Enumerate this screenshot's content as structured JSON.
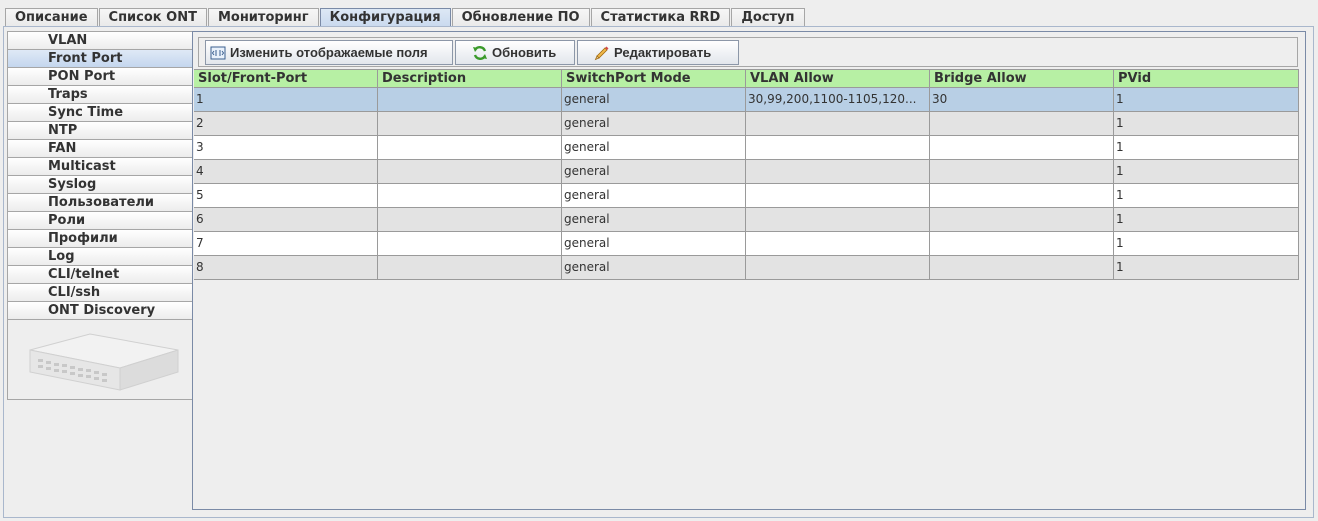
{
  "tabs": [
    {
      "label": "Описание",
      "active": false
    },
    {
      "label": "Список ONT",
      "active": false
    },
    {
      "label": "Мониторинг",
      "active": false
    },
    {
      "label": "Конфигурация",
      "active": true
    },
    {
      "label": "Обновление ПО",
      "active": false
    },
    {
      "label": "Статистика RRD",
      "active": false
    },
    {
      "label": "Доступ",
      "active": false
    }
  ],
  "sidebar": {
    "items": [
      {
        "label": "VLAN",
        "active": false
      },
      {
        "label": "Front Port",
        "active": true
      },
      {
        "label": "PON Port",
        "active": false
      },
      {
        "label": "Traps",
        "active": false
      },
      {
        "label": "Sync Time",
        "active": false
      },
      {
        "label": "NTP",
        "active": false
      },
      {
        "label": "FAN",
        "active": false
      },
      {
        "label": "Multicast",
        "active": false
      },
      {
        "label": "Syslog",
        "active": false
      },
      {
        "label": "Пользователи",
        "active": false
      },
      {
        "label": "Роли",
        "active": false
      },
      {
        "label": "Профили",
        "active": false
      },
      {
        "label": "Log",
        "active": false
      },
      {
        "label": "CLI/telnet",
        "active": false
      },
      {
        "label": "CLI/ssh",
        "active": false
      },
      {
        "label": "ONT Discovery",
        "active": false
      }
    ]
  },
  "toolbar": {
    "fields_label": "Изменить отображаемые поля",
    "refresh_label": "Обновить",
    "edit_label": "Редактировать"
  },
  "table": {
    "headers": [
      "Slot/Front-Port",
      "Description",
      "SwitchPort Mode",
      "VLAN Allow",
      "Bridge Allow",
      "PVid"
    ],
    "rows": [
      [
        "1",
        "",
        "general",
        "30,99,200,1100-1105,120...",
        "30",
        "1"
      ],
      [
        "2",
        "",
        "general",
        "",
        "",
        "1"
      ],
      [
        "3",
        "",
        "general",
        "",
        "",
        "1"
      ],
      [
        "4",
        "",
        "general",
        "",
        "",
        "1"
      ],
      [
        "5",
        "",
        "general",
        "",
        "",
        "1"
      ],
      [
        "6",
        "",
        "general",
        "",
        "",
        "1"
      ],
      [
        "7",
        "",
        "general",
        "",
        "",
        "1"
      ],
      [
        "8",
        "",
        "general",
        "",
        "",
        "1"
      ]
    ],
    "selected_row": 0
  },
  "colors": {
    "header_bg": "#b7f0a4",
    "selected_row": "#b8cfe5",
    "active_tab": "#c9d9ee"
  },
  "icons": {
    "fields": "columns-icon",
    "refresh": "refresh-icon",
    "edit": "pencil-icon",
    "device": "switch-device-icon"
  }
}
